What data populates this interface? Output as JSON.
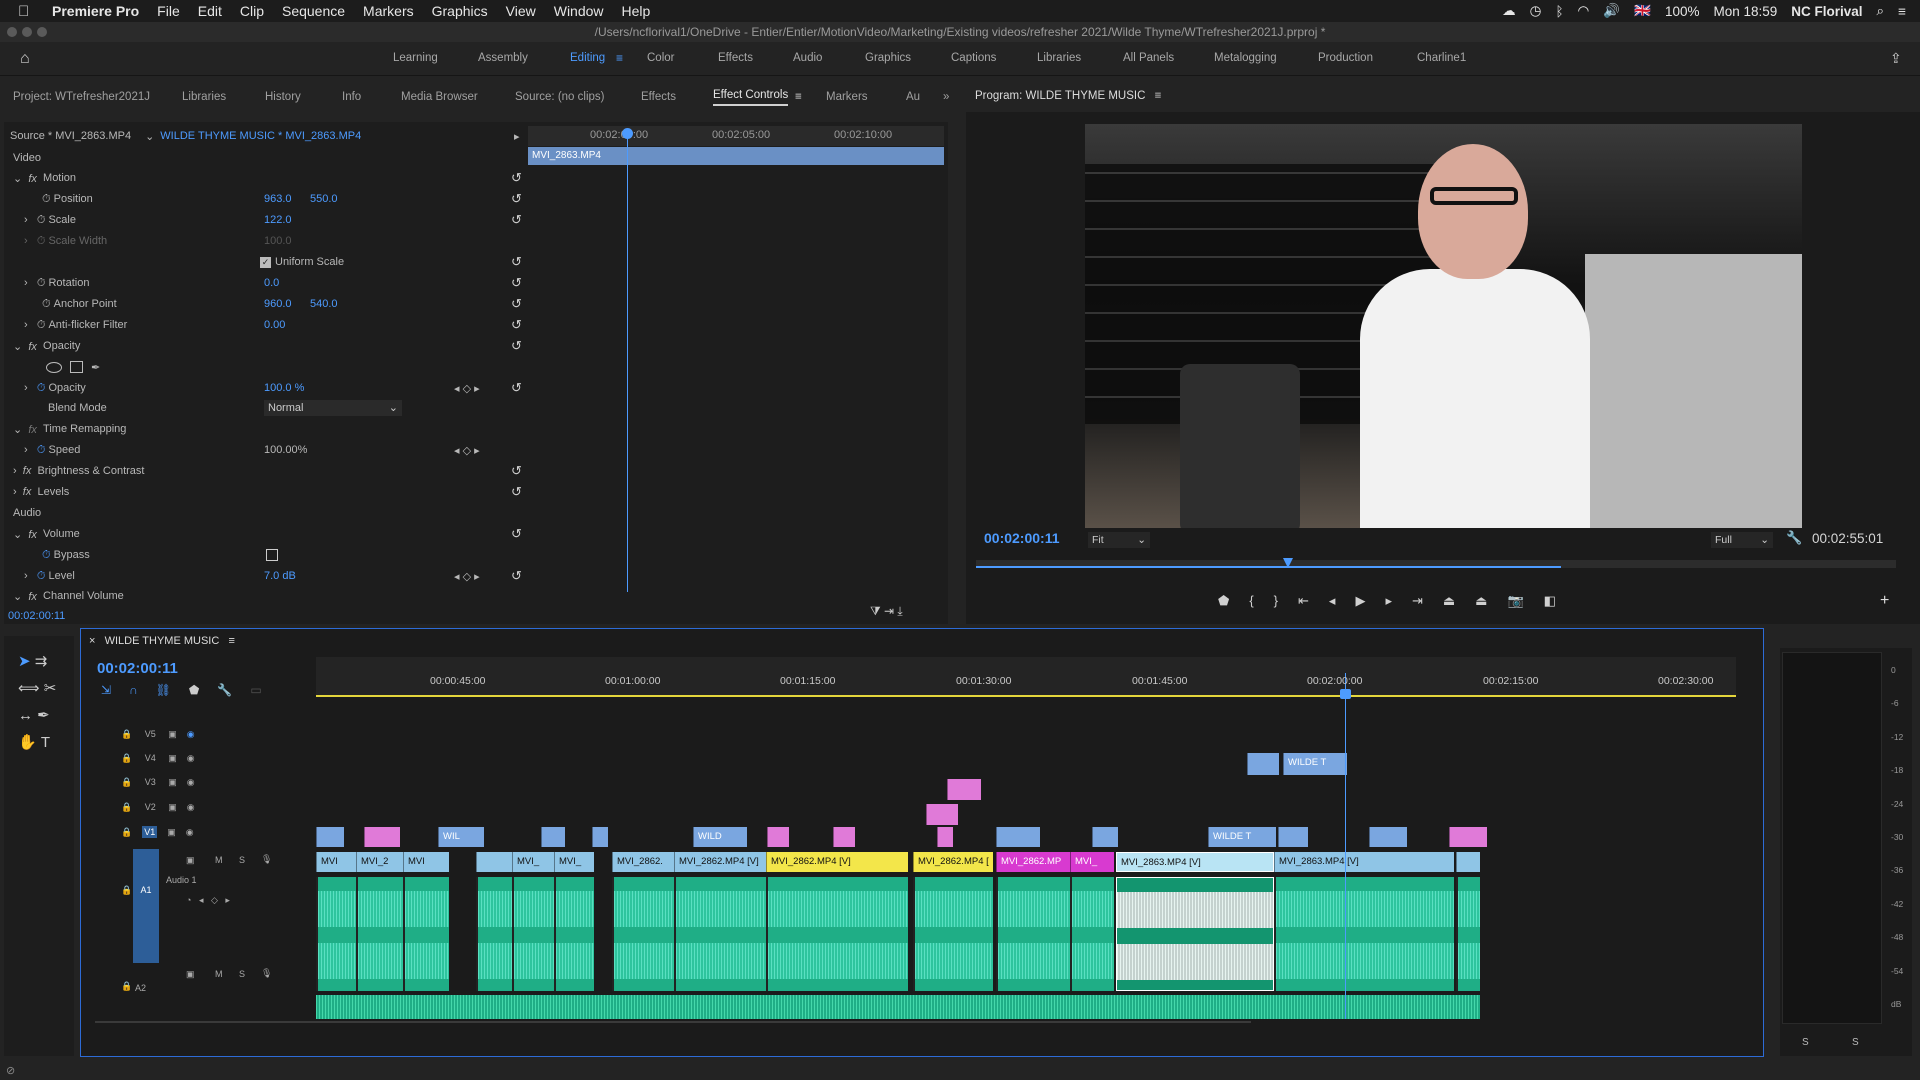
{
  "menubar": {
    "apple": "",
    "app": "Premiere Pro",
    "items": [
      "File",
      "Edit",
      "Clip",
      "Sequence",
      "Markers",
      "Graphics",
      "View",
      "Window",
      "Help"
    ],
    "battery": "100%",
    "flag": "🇬🇧",
    "datetime": "Mon 18:59",
    "user": "NC Florival"
  },
  "titlebar": {
    "path": "/Users/ncflorival1/OneDrive - Entier/Entier/MotionVideo/Marketing/Existing videos/refresher 2021/Wilde Thyme/WTrefresher2021J.prproj *"
  },
  "workspaces": [
    "Learning",
    "Assembly",
    "Editing",
    "Color",
    "Effects",
    "Audio",
    "Graphics",
    "Captions",
    "Libraries",
    "All Panels",
    "Metalogging",
    "Production",
    "Charline1"
  ],
  "left_tabs": [
    "Project: WTrefresher2021J",
    "Libraries",
    "History",
    "Info",
    "Media Browser",
    "Source: (no clips)",
    "Effects",
    "Effect Controls",
    "Markers",
    "Au"
  ],
  "program_title": "Program: WILDE THYME MUSIC",
  "effect_controls": {
    "source": "Source * MVI_2863.MP4",
    "sequence": "WILDE THYME MUSIC * MVI_2863.MP4",
    "ruler": [
      "00:02:00:00",
      "00:02:05:00",
      "00:02:10:00"
    ],
    "clip_name": "MVI_2863.MP4",
    "video_label": "Video",
    "motion": "Motion",
    "position_label": "Position",
    "position_x": "963.0",
    "position_y": "550.0",
    "scale_label": "Scale",
    "scale": "122.0",
    "scale_width_label": "Scale Width",
    "scale_width": "100.0",
    "uniform_scale": "Uniform Scale",
    "rotation_label": "Rotation",
    "rotation": "0.0",
    "anchor_label": "Anchor Point",
    "anchor_x": "960.0",
    "anchor_y": "540.0",
    "antiflicker_label": "Anti-flicker Filter",
    "antiflicker": "0.00",
    "opacity_group": "Opacity",
    "opacity_label": "Opacity",
    "opacity": "100.0 %",
    "blend_label": "Blend Mode",
    "blend": "Normal",
    "time_remap": "Time Remapping",
    "speed_label": "Speed",
    "speed": "100.00%",
    "brightness": "Brightness & Contrast",
    "levels": "Levels",
    "audio_label": "Audio",
    "volume": "Volume",
    "bypass_label": "Bypass",
    "level_label": "Level",
    "level": "7.0 dB",
    "channel_volume": "Channel Volume",
    "timecode": "00:02:00:11"
  },
  "program": {
    "timecode": "00:02:00:11",
    "fit": "Fit",
    "full": "Full",
    "duration": "00:02:55:01"
  },
  "timeline": {
    "title": "WILDE THYME MUSIC",
    "timecode": "00:02:00:11",
    "ruler": [
      "00:00:45:00",
      "00:01:00:00",
      "00:01:15:00",
      "00:01:30:00",
      "00:01:45:00",
      "00:02:00:00",
      "00:02:15:00",
      "00:02:30:00"
    ],
    "tracks": [
      "V5",
      "V4",
      "V3",
      "V2",
      "V1",
      "A1",
      "A2"
    ],
    "audio1_name": "Audio 1",
    "v1_clips": [
      "MVI",
      "MVI_2",
      "MVI",
      "MVI_",
      "MVI_",
      "MVI_2862.",
      "MVI_2862.MP4 [V]",
      "MVI_2862.MP4 [V]",
      "MVI_2862.MP4 [",
      "MVI_2862.MP",
      "MVI_",
      "MVI_2863.MP4 [V]",
      "MVI_2863.MP4 [V]"
    ],
    "v2_clips": [
      "WIL",
      "WILD",
      "WILDE T"
    ],
    "v5_clip": "WILDE T",
    "meter_scale": [
      "0",
      "-6",
      "-12",
      "-18",
      "-24",
      "-30",
      "-36",
      "-42",
      "-48",
      "-54",
      "dB"
    ],
    "meter_solo": [
      "S",
      "S"
    ]
  },
  "colors": {
    "accent": "#4d9bff",
    "v1_blue": "#8fc5e6",
    "v1_yellow": "#f3e64a",
    "v1_magenta": "#d83ad0",
    "pink": "#e07ad8",
    "audio": "#1fae86"
  }
}
